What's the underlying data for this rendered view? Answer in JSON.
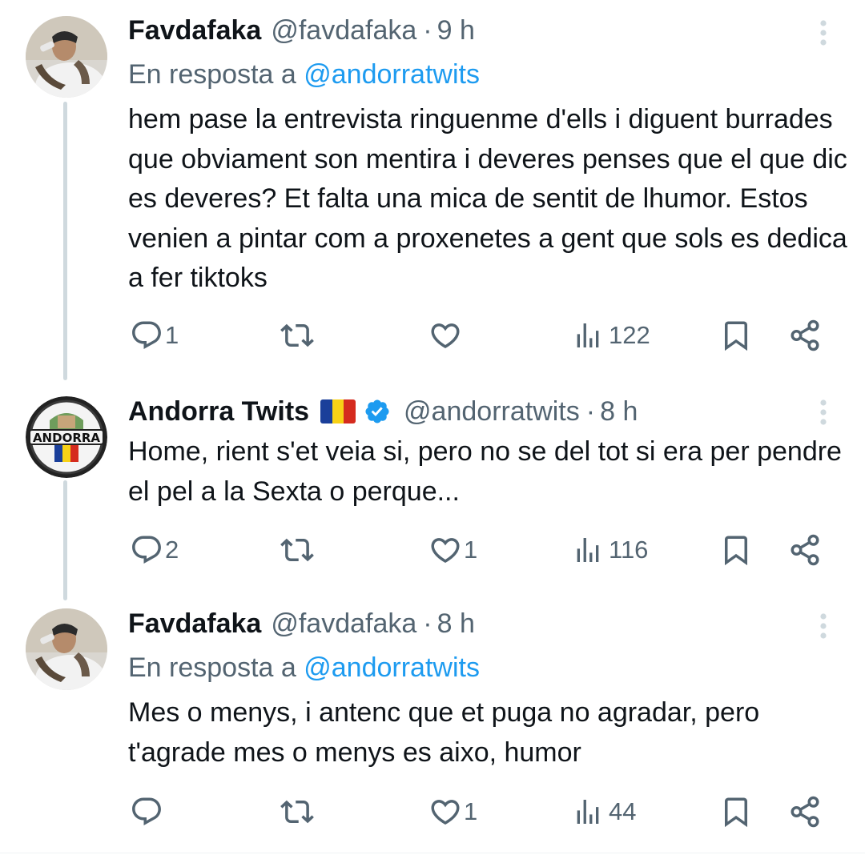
{
  "tweets": [
    {
      "name": "Favdafaka",
      "handle": "@favdafaka",
      "separator": "·",
      "time": "9 h",
      "reply_prefix": "En resposta a",
      "reply_handle": "@andorratwits",
      "text": "hem pase la entrevista ringuenme d'ells i diguent burrades que obviament son mentira i deveres penses que el que dic es deveres? Et falta una mica de sentit de lhumor. Estos venien a pintar com a proxenetes a gent que sols es dedica a fer tiktoks",
      "replies": "1",
      "retweets": "",
      "likes": "",
      "views": "122",
      "icons": [
        "reply-icon",
        "retweet-icon",
        "like-icon",
        "views-icon",
        "bookmark-icon",
        "share-icon"
      ]
    },
    {
      "name": "Andorra Twits",
      "handle": "@andorratwits",
      "separator": "·",
      "time": "8 h",
      "avatar_text": "ANDORRA",
      "text": "Home, rient s'et veia si, pero no se del tot si era per pendre el pel a la Sexta o perque...",
      "replies": "2",
      "retweets": "",
      "likes": "1",
      "views": "116",
      "icons": [
        "reply-icon",
        "retweet-icon",
        "like-icon",
        "views-icon",
        "bookmark-icon",
        "share-icon"
      ]
    },
    {
      "name": "Favdafaka",
      "handle": "@favdafaka",
      "separator": "·",
      "time": "8 h",
      "reply_prefix": "En resposta a",
      "reply_handle": "@andorratwits",
      "text": "Mes o menys, i antenc que et puga no agradar, pero t'agrade mes o menys es aixo, humor",
      "replies": "",
      "retweets": "",
      "likes": "1",
      "views": "44",
      "icons": [
        "reply-icon",
        "retweet-icon",
        "like-icon",
        "views-icon",
        "bookmark-icon",
        "share-icon"
      ]
    }
  ],
  "colors": {
    "text": "#0f1419",
    "secondary": "#536471",
    "link": "#1d9bf0",
    "thread_line": "#cfd9de",
    "verified": "#1d9bf0",
    "flag": [
      "#1a3f9a",
      "#f7d116",
      "#d52b1e"
    ]
  }
}
